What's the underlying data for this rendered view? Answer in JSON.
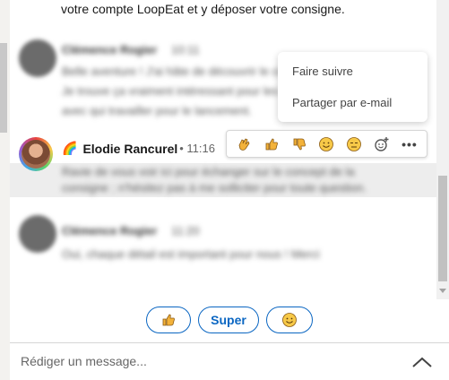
{
  "conversation": {
    "top_text": "votre compte LoopEat et y déposer votre consigne.",
    "blurred_message_1": {
      "name": "Clémence Rogier",
      "time": "10:11",
      "lines": [
        "Belle aventure ! J'ai hâte de découvrir le concept.",
        "Je trouve ça vraiment intéressant pour les restaurants",
        "avec qui travailler pour le lancement."
      ]
    },
    "elodie": {
      "flag": "🌈",
      "name": "Elodie Rancurel",
      "time": "• 11:16",
      "blurred_lines": [
        "Ravie de vous voir ici pour échanger sur le concept de la",
        "consigne ; n'hésitez pas à me solliciter pour toute question."
      ]
    },
    "blurred_message_2": {
      "name": "Clémence Rogier",
      "time": "11:20",
      "line": "Oui, chaque détail est important pour nous ! Merci"
    }
  },
  "reaction_bar": {
    "icons": [
      "clap-icon",
      "thumbs-up-icon",
      "thumbs-down-icon",
      "smile-icon",
      "sad-icon",
      "add-reaction-icon",
      "more-icon"
    ],
    "more_label": "•••"
  },
  "menu": {
    "items": [
      "Faire suivre",
      "Partager par e-mail"
    ]
  },
  "quick_replies": {
    "thumbs": "👍",
    "super": "Super",
    "smile": "😊"
  },
  "composer": {
    "placeholder": "Rédiger un message..."
  },
  "colors": {
    "accent": "#0a66c2",
    "highlight": "#ededed"
  }
}
